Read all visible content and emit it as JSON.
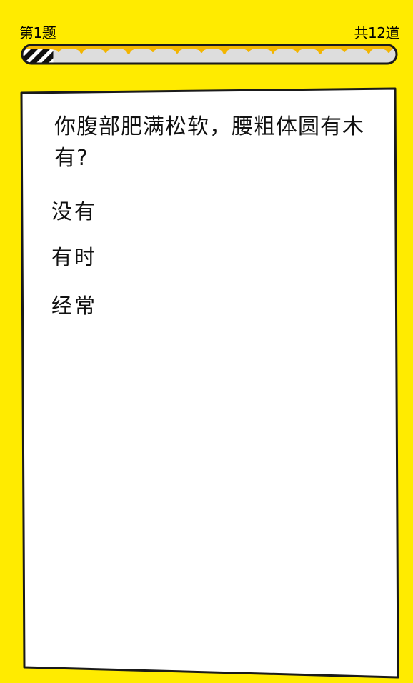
{
  "header": {
    "current_question": "第1题",
    "total_questions": "共12道"
  },
  "progress": {
    "fraction": 0.083
  },
  "colors": {
    "background": "#FFEB00",
    "card": "#FFFFFF",
    "outline": "#1A1A1A",
    "track": "#DDDDDD",
    "honey": "#F2B500"
  },
  "question": {
    "text": "你腹部肥满松软，腰粗体圆有木有?",
    "options": [
      {
        "label": "没有"
      },
      {
        "label": "有时"
      },
      {
        "label": "经常"
      }
    ]
  }
}
